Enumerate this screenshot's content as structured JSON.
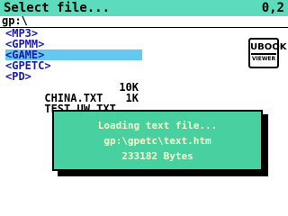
{
  "window": {
    "title": "Select file...",
    "page_indicator": "0,2"
  },
  "path": "gp:\\",
  "list": [
    {
      "name": "<MP3>",
      "type": "dir",
      "selected": false,
      "size": ""
    },
    {
      "name": "<GPMM>",
      "type": "dir",
      "selected": false,
      "size": ""
    },
    {
      "name": "<GAME>",
      "type": "dir",
      "selected": true,
      "size": ""
    },
    {
      "name": "<GPETC>",
      "type": "dir",
      "selected": false,
      "size": ""
    },
    {
      "name": "<PD>",
      "type": "dir",
      "selected": false,
      "size": ""
    },
    {
      "name": "CHINA.TXT",
      "type": "file",
      "selected": false,
      "size": "10K"
    },
    {
      "name": "TEST_UW.TXT",
      "type": "file",
      "selected": false,
      "size": "1K"
    }
  ],
  "app_icon": {
    "name": "ubook-viewer-logo",
    "text_main": "UBOOK",
    "text_sub": "VIEWER"
  },
  "dialog": {
    "line1": "Loading text file...",
    "line2": "gp:\\gpetc\\text.htm",
    "line3": "233182 Bytes"
  },
  "colors": {
    "titlebar": "#5cdcbc",
    "selection": "#64c8f0",
    "dir_text": "#1a1aa8",
    "dialog_bg": "#48d0a0",
    "dialog_text": "#f8f8c8"
  }
}
